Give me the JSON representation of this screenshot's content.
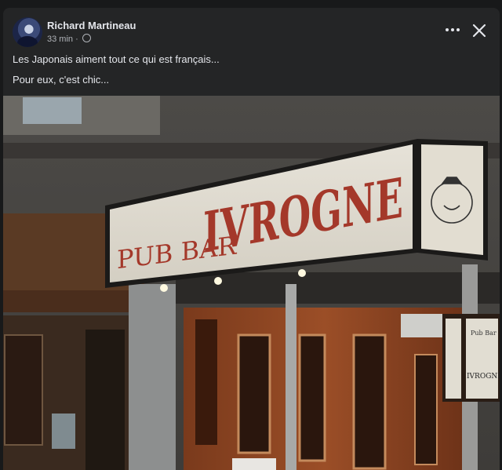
{
  "post": {
    "author": "Richard Martineau",
    "time": "33 min",
    "separator": "·",
    "lines": [
      "Les Japonais aiment tout ce qui est français...",
      "Pour eux, c'est chic..."
    ]
  },
  "icons": {
    "more": "more-options-icon",
    "close": "close-icon",
    "audience": "globe-icon"
  },
  "photo": {
    "sign_left": "PUB BAR",
    "sign_main": "IVROGNE",
    "small_sign_top": "Pub Bar",
    "small_sign_bottom": "IVROGNE"
  },
  "colors": {
    "background": "#18191a",
    "card": "#242526",
    "text": "#e4e6eb",
    "muted": "#b0b3b8",
    "sign_red": "#a4382a"
  }
}
